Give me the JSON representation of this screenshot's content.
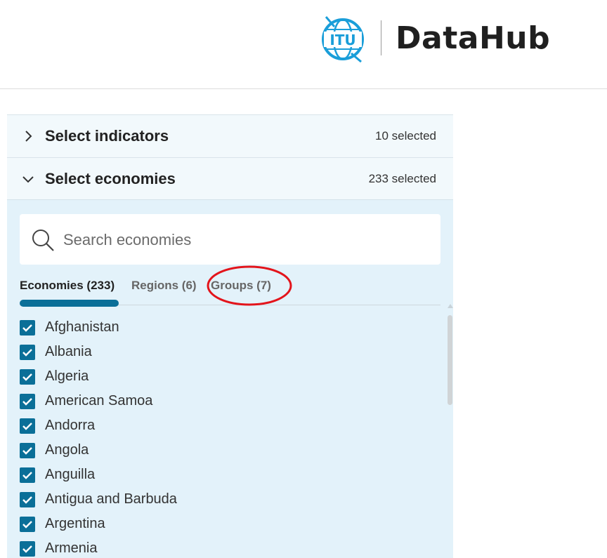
{
  "header": {
    "logo_text": "ITU",
    "brand": "DataHub"
  },
  "indicators": {
    "title": "Select indicators",
    "count": "10 selected",
    "expanded": false
  },
  "economies": {
    "title": "Select economies",
    "count": "233 selected",
    "expanded": true
  },
  "search": {
    "placeholder": "Search economies",
    "value": ""
  },
  "tabs": [
    {
      "label": "Economies (233)",
      "active": true
    },
    {
      "label": "Regions (6)",
      "active": false
    },
    {
      "label": "Groups (7)",
      "active": false
    }
  ],
  "list": [
    {
      "label": "Afghanistan",
      "checked": true
    },
    {
      "label": "Albania",
      "checked": true
    },
    {
      "label": "Algeria",
      "checked": true
    },
    {
      "label": "American Samoa",
      "checked": true
    },
    {
      "label": "Andorra",
      "checked": true
    },
    {
      "label": "Angola",
      "checked": true
    },
    {
      "label": "Anguilla",
      "checked": true
    },
    {
      "label": "Antigua and Barbuda",
      "checked": true
    },
    {
      "label": "Argentina",
      "checked": true
    },
    {
      "label": "Armenia",
      "checked": true
    }
  ],
  "colors": {
    "accent": "#0a6f98",
    "panel": "#e3f2fa",
    "annotation": "#e3141b",
    "logo": "#1a9ed9"
  }
}
